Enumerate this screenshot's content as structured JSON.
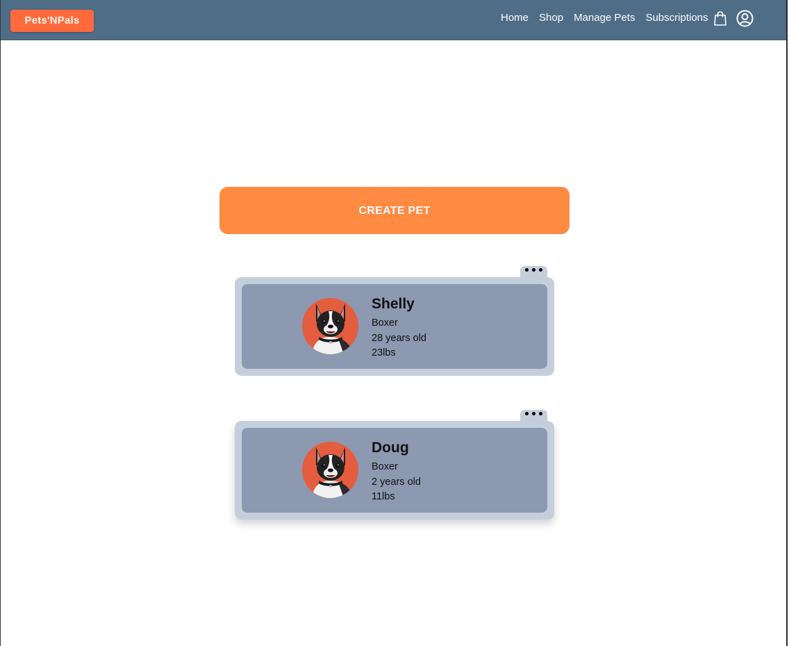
{
  "brand": {
    "logo_text": "Pets'NPals",
    "color": "#ff6a3d"
  },
  "navbar": {
    "background": "#4f6d86",
    "links": [
      {
        "label": "Home"
      },
      {
        "label": "Shop"
      },
      {
        "label": "Manage Pets"
      },
      {
        "label": "Subscriptions"
      }
    ],
    "icons": [
      "shopping-bag-icon",
      "account-circle-icon"
    ]
  },
  "main": {
    "create_button_label": "CREATE PET",
    "create_button_color": "#ff8a41",
    "pets": [
      {
        "name": "Shelly",
        "breed": "Boxer",
        "age": "28 years old",
        "weight": "23lbs",
        "avatar": "dog-photo"
      },
      {
        "name": "Doug",
        "breed": "Boxer",
        "age": "2 years old",
        "weight": "11lbs",
        "avatar": "dog-photo"
      }
    ],
    "card_menu_icon": "more-dots-icon"
  }
}
